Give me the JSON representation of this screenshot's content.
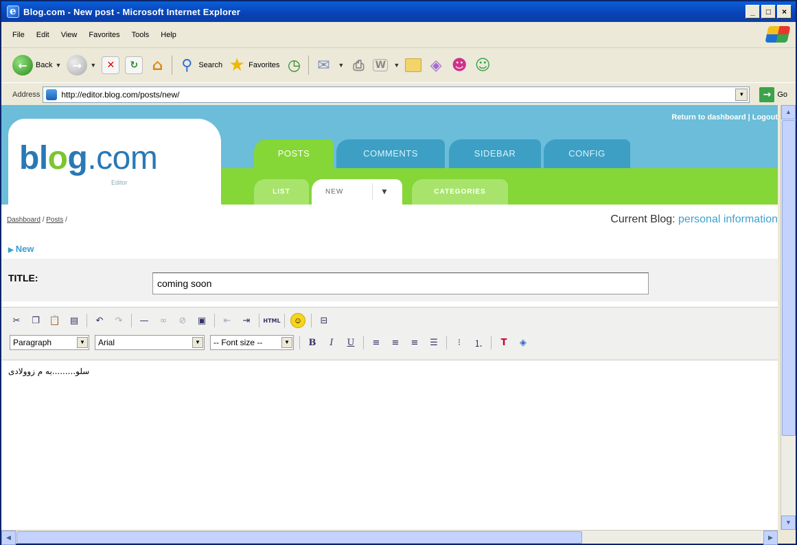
{
  "window": {
    "title": "Blog.com - New post - Microsoft Internet Explorer"
  },
  "menu": [
    "File",
    "Edit",
    "View",
    "Favorites",
    "Tools",
    "Help"
  ],
  "toolbar": {
    "back_label": "Back",
    "search_label": "Search",
    "favorites_label": "Favorites"
  },
  "address": {
    "label": "Address",
    "url": "http://editor.blog.com/posts/new/",
    "go_label": "Go"
  },
  "site": {
    "logo_prefix": "bl",
    "logo_dot": "o",
    "logo_mid": "g",
    "logo_suffix": ".com",
    "logo_sub": "Editor",
    "top_links": "Return to dashboard | Logout",
    "tabs": [
      "POSTS",
      "COMMENTS",
      "SIDEBAR",
      "CONFIG"
    ],
    "subtabs": [
      "LIST",
      "NEW",
      "CATEGORIES"
    ]
  },
  "breadcrumb": [
    "Dashboard",
    "Posts"
  ],
  "current_blog": {
    "label": "Current Blog:",
    "name": "personal information"
  },
  "section": {
    "title": "New"
  },
  "post": {
    "title_label": "TITLE:",
    "title_value": "coming soon",
    "body": "سلو.........به م زوولادی"
  },
  "editor": {
    "format_select": "Paragraph",
    "font_select": "Arial",
    "size_select": "-- Font size --"
  }
}
